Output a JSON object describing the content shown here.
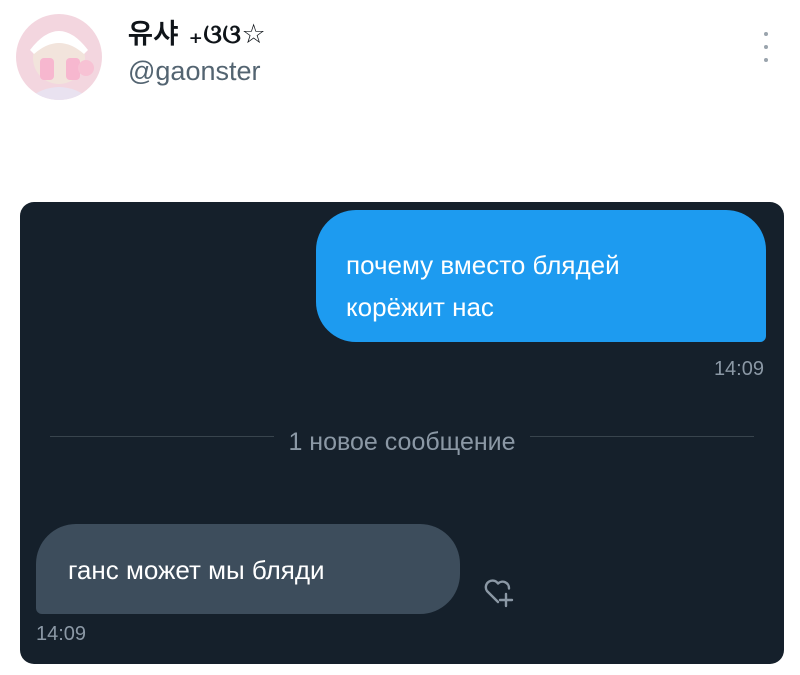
{
  "profile": {
    "display_name": "유샤 ₊ଓଓ☆",
    "handle": "@gaonster"
  },
  "conversation": {
    "outgoing_message": {
      "lines": [
        "почему вместо блядей",
        "корёжит нас"
      ],
      "time": "14:09"
    },
    "new_messages_divider": "1 новое сообщение",
    "incoming_message": {
      "text": "ганс может мы бляди",
      "time": "14:09"
    }
  },
  "icons": {
    "more": "more-vertical-icon",
    "reaction": "heart-add-icon"
  },
  "colors": {
    "chat_background": "#15202b",
    "outgoing_bubble": "#1d9bf0",
    "incoming_bubble": "#3d4d5c",
    "muted_text": "#8b98a5"
  }
}
